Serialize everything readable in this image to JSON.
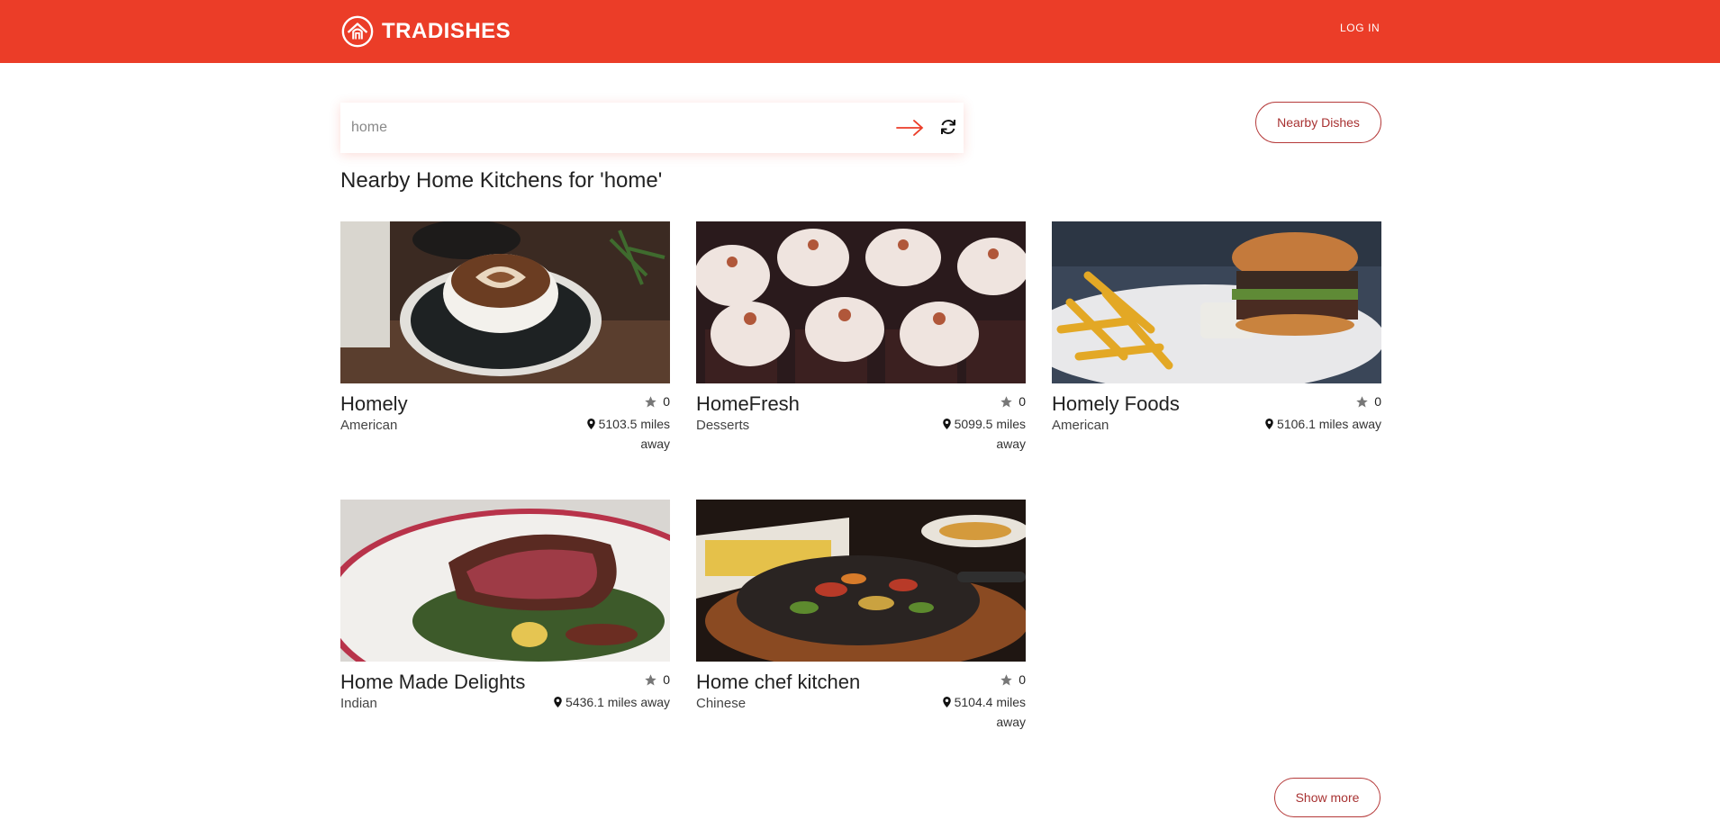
{
  "header": {
    "brand": "TRADISHES",
    "login_label": "LOG IN",
    "accent": "#eb3d28"
  },
  "search": {
    "value": "home",
    "go_icon": "arrow-right-icon",
    "refresh_icon": "refresh-icon"
  },
  "nearby_dishes_label": "Nearby Dishes",
  "results_heading": "Nearby Home Kitchens for 'home'",
  "kitchens": [
    {
      "name": "Homely",
      "cuisine": "American",
      "rating": "0",
      "distance": "5103.5 miles away",
      "image": "coffee-latte-art"
    },
    {
      "name": "HomeFresh",
      "cuisine": "Desserts",
      "rating": "0",
      "distance": "5099.5 miles away",
      "image": "cupcakes"
    },
    {
      "name": "Homely Foods",
      "cuisine": "American",
      "rating": "0",
      "distance": "5106.1 miles away",
      "image": "burger-and-fries"
    },
    {
      "name": "Home Made Delights",
      "cuisine": "Indian",
      "rating": "0",
      "distance": "5436.1 miles away",
      "image": "sliced-steak"
    },
    {
      "name": "Home chef kitchen",
      "cuisine": "Chinese",
      "rating": "0",
      "distance": "5104.4 miles away",
      "image": "sizzling-fajitas"
    }
  ],
  "show_more_label": "Show more"
}
